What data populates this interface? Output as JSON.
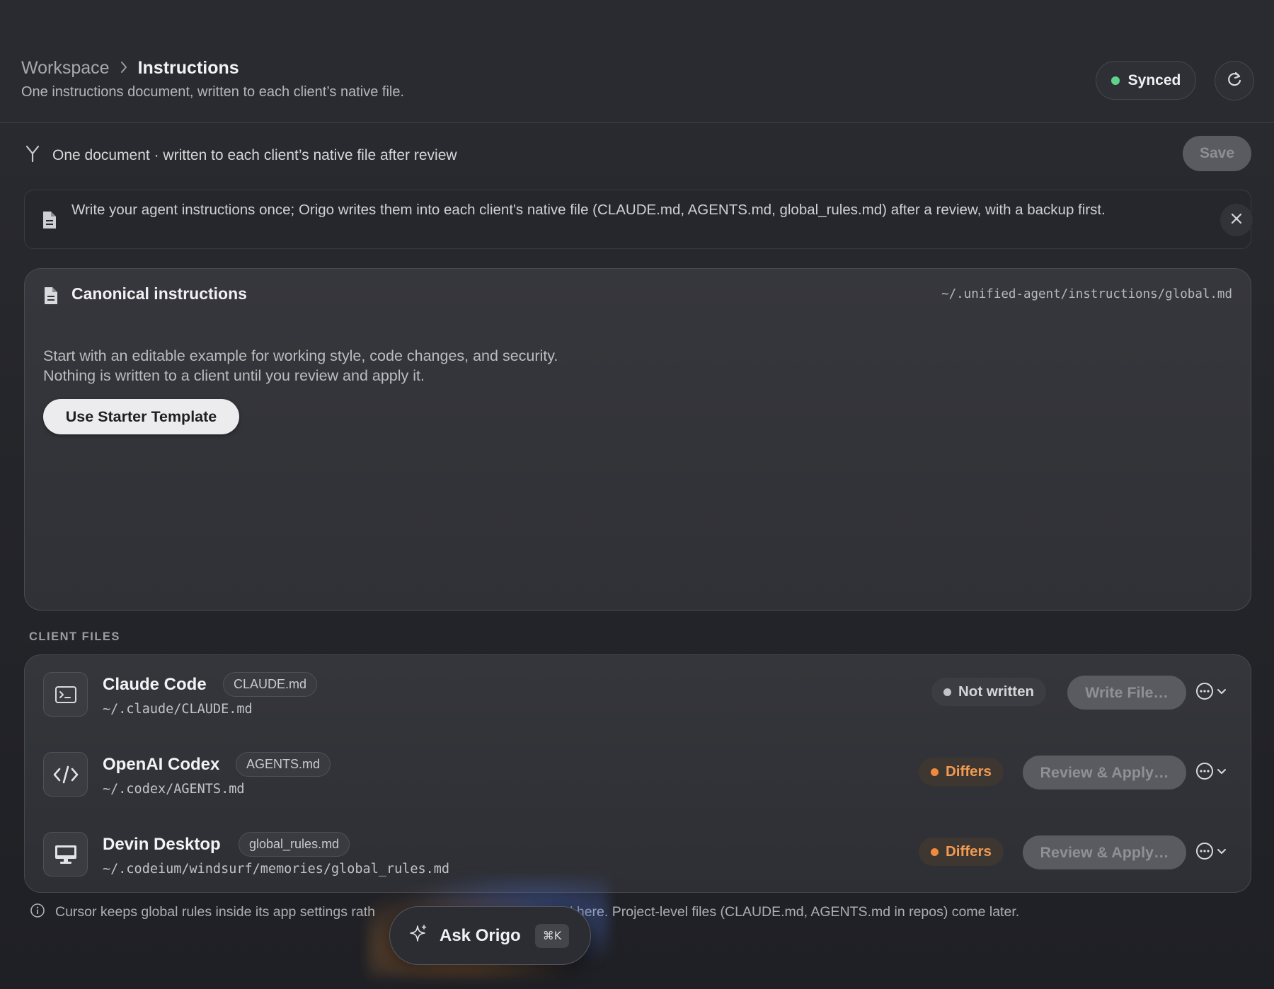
{
  "header": {
    "breadcrumb_parent": "Workspace",
    "breadcrumb_current": "Instructions",
    "subtitle": "One instructions document, written to each client’s native file.",
    "sync_status": "Synced",
    "refresh_icon": "refresh-icon"
  },
  "toolbar": {
    "icon": "merge-icon",
    "text": "One document · written to each client’s native file after review",
    "save_label": "Save"
  },
  "banner": {
    "icon": "document-icon",
    "text": "Write your agent instructions once; Origo writes them into each client's native file (CLAUDE.md, AGENTS.md, global_rules.md) after a review, with a backup first.",
    "close_icon": "close-icon"
  },
  "canonical": {
    "icon": "document-icon",
    "title": "Canonical instructions",
    "path": "~/.unified-agent/instructions/global.md",
    "description_line1": "Start with an editable example for working style, code changes, and security.",
    "description_line2": "Nothing is written to a client until you review and apply it.",
    "starter_label": "Use Starter Template"
  },
  "clients": {
    "section_label": "CLIENT FILES",
    "items": [
      {
        "name": "Claude Code",
        "file": "CLAUDE.md",
        "path": "~/.claude/CLAUDE.md",
        "status": "Not written",
        "action": "Write File…",
        "icon": "terminal-icon"
      },
      {
        "name": "OpenAI Codex",
        "file": "AGENTS.md",
        "path": "~/.codex/AGENTS.md",
        "status": "Differs",
        "action": "Review & Apply…",
        "icon": "code-icon"
      },
      {
        "name": "Devin Desktop",
        "file": "global_rules.md",
        "path": "~/.codeium/windsurf/memories/global_rules.md",
        "status": "Differs",
        "action": "Review & Apply…",
        "icon": "monitor-icon"
      }
    ]
  },
  "footer": {
    "note_left": "Cursor keeps global rules inside its app settings rath",
    "note_right": "ced here. Project-level files (CLAUDE.md, AGENTS.md in repos) come later."
  },
  "ask": {
    "label": "Ask Origo",
    "shortcut": "⌘K"
  },
  "colors": {
    "synced": "#5fd38a",
    "differs": "#f29b52"
  }
}
